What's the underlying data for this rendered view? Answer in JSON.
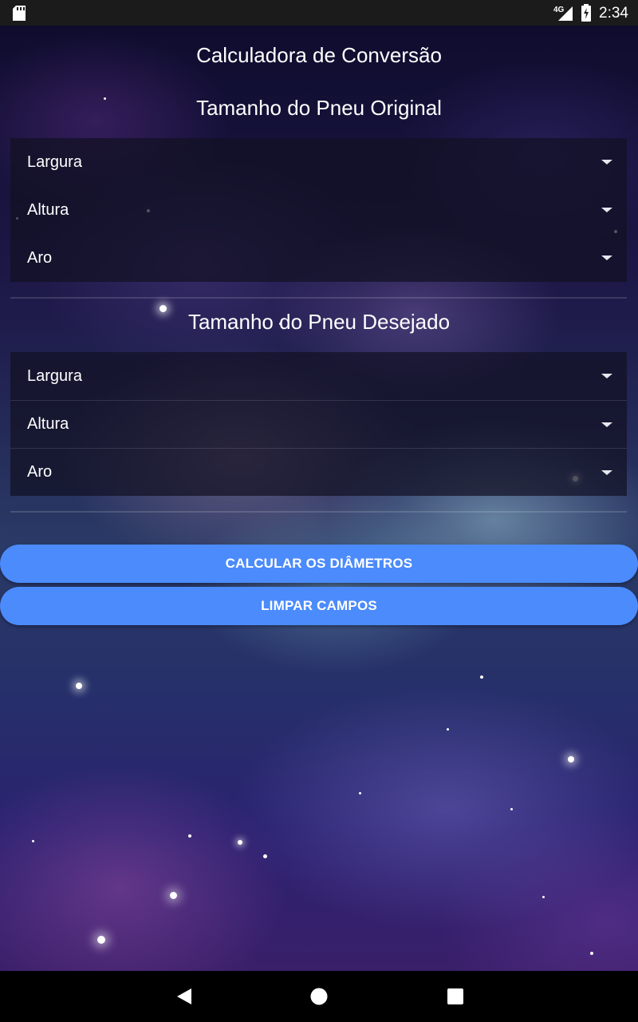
{
  "status_bar": {
    "network": "4G",
    "time": "2:34",
    "icons": [
      "sd-card-icon",
      "signal-icon",
      "battery-charging-icon"
    ]
  },
  "app_title": "Calculadora de Conversão",
  "original": {
    "heading": "Tamanho do Pneu Original",
    "fields": [
      "Largura",
      "Altura",
      "Aro"
    ]
  },
  "desired": {
    "heading": "Tamanho do Pneu Desejado",
    "fields": [
      "Largura",
      "Altura",
      "Aro"
    ]
  },
  "buttons": {
    "calculate": "CALCULAR OS DIÂMETROS",
    "clear": "LIMPAR CAMPOS",
    "color": "#4b8bfb"
  },
  "nav_bar": {
    "icons": [
      "back-icon",
      "home-icon",
      "recents-icon"
    ]
  }
}
